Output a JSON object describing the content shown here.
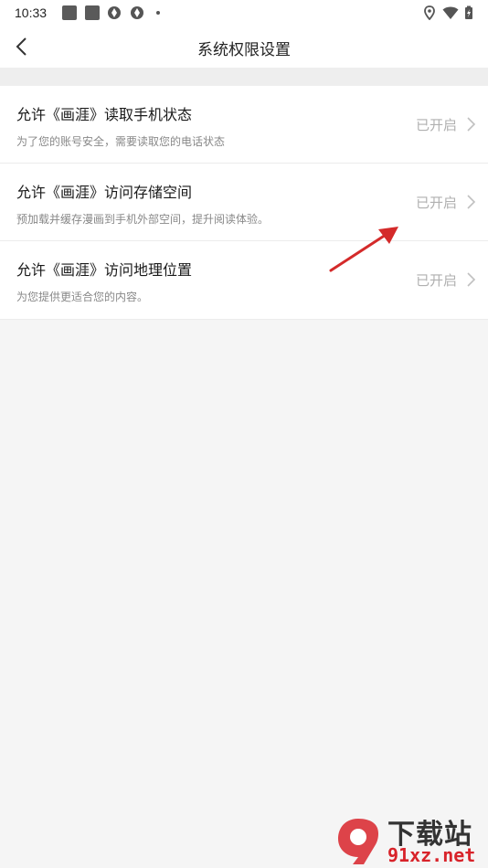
{
  "status_bar": {
    "time": "10:33"
  },
  "header": {
    "title": "系统权限设置"
  },
  "permissions": [
    {
      "title": "允许《画涯》读取手机状态",
      "desc": "为了您的账号安全，需要读取您的电话状态",
      "status": "已开启"
    },
    {
      "title": "允许《画涯》访问存储空间",
      "desc": "预加载并缓存漫画到手机外部空间，提升阅读体验。",
      "status": "已开启"
    },
    {
      "title": "允许《画涯》访问地理位置",
      "desc": "为您提供更适合您的内容。",
      "status": "已开启"
    }
  ],
  "watermark": {
    "top_text": "下载站",
    "bottom_text": "91xz.net"
  },
  "colors": {
    "arrow": "#d42a2a",
    "watermark_red": "#d8232a"
  }
}
